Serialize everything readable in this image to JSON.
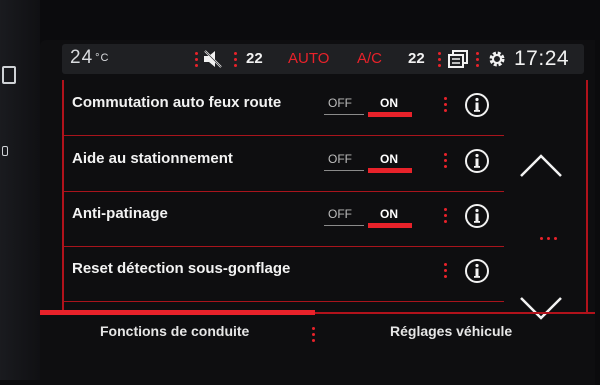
{
  "status_bar": {
    "outside_temp": "24",
    "outside_temp_unit": "°C",
    "temp_left": "22",
    "auto_label": "AUTO",
    "ac_label": "A/C",
    "temp_right": "22",
    "clock": "17:24",
    "accent_color": "#e8222a"
  },
  "settings": {
    "rows": [
      {
        "label": "Commutation auto feux route",
        "off": "OFF",
        "on": "ON",
        "state": "ON"
      },
      {
        "label": "Aide au stationnement",
        "off": "OFF",
        "on": "ON",
        "state": "ON"
      },
      {
        "label": "Anti-patinage",
        "off": "OFF",
        "on": "ON",
        "state": "ON"
      },
      {
        "label": "Reset détection sous-gonflage"
      }
    ]
  },
  "tabs": {
    "left": "Fonctions de conduite",
    "right": "Réglages véhicule",
    "active": "left"
  },
  "icons": {
    "mute": "mute-icon",
    "screens": "screens-icon",
    "settings": "gear-icon",
    "info": "info-icon",
    "up": "chevron-up-icon",
    "down": "chevron-down-icon"
  }
}
